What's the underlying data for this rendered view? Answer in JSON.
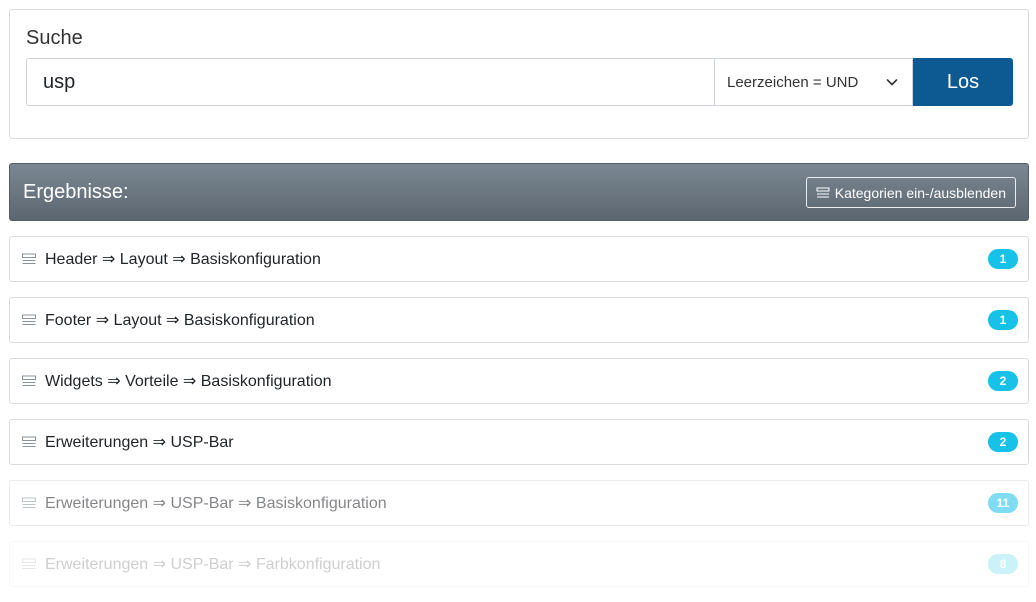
{
  "search": {
    "title": "Suche",
    "value": "usp",
    "mode_selected": "Leerzeichen = UND",
    "submit_label": "Los"
  },
  "results": {
    "title": "Ergebnisse:",
    "toggle_label": "Kategorien ein-/ausblenden",
    "items": [
      {
        "label": "Header ⇒ Layout ⇒ Basiskonfiguration",
        "count": "1"
      },
      {
        "label": "Footer ⇒ Layout ⇒ Basiskonfiguration",
        "count": "1"
      },
      {
        "label": "Widgets ⇒ Vorteile ⇒ Basiskonfiguration",
        "count": "2"
      },
      {
        "label": "Erweiterungen ⇒ USP-Bar",
        "count": "2"
      },
      {
        "label": "Erweiterungen ⇒ USP-Bar ⇒ Basiskonfiguration",
        "count": "11"
      },
      {
        "label": "Erweiterungen ⇒ USP-Bar ⇒ Farbkonfiguration",
        "count": "8"
      }
    ]
  },
  "colors": {
    "primary_button": "#0d5a93",
    "badge": "#17c1e8",
    "header_gradient_top": "#7b8792",
    "header_gradient_bottom": "#5b6670"
  },
  "icons": {
    "item": "list-toggle-icon",
    "toggle": "list-toggle-icon",
    "select": "chevron-down-icon"
  }
}
